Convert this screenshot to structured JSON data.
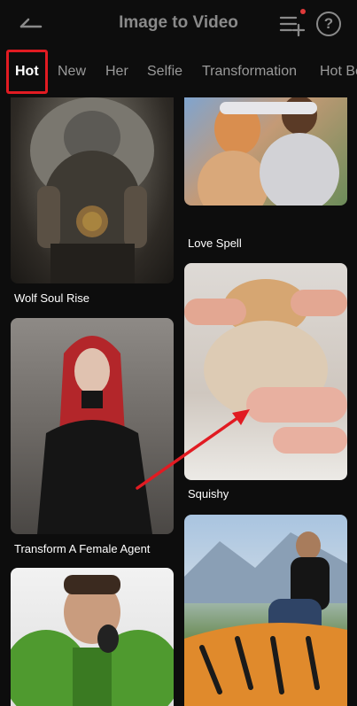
{
  "header": {
    "title": "Image to Video",
    "back_icon": "back-arrow-icon",
    "queue_icon": "task-list-icon",
    "help_icon": "help-circle-icon",
    "help_glyph": "?"
  },
  "tabs": [
    {
      "label": "Hot",
      "active": true
    },
    {
      "label": "New",
      "active": false
    },
    {
      "label": "Her",
      "active": false
    },
    {
      "label": "Selfie",
      "active": false
    },
    {
      "label": "Transformation",
      "active": false
    },
    {
      "label": "Hot Be",
      "active": false
    }
  ],
  "cards": {
    "wolf": {
      "caption": "Wolf Soul Rise"
    },
    "love": {
      "caption": "Love Spell"
    },
    "agent": {
      "caption": "Transform A Female Agent"
    },
    "squishy": {
      "caption": "Squishy"
    },
    "hulk": {
      "caption": ""
    },
    "tiger": {
      "caption": ""
    }
  },
  "colors": {
    "background": "#0d0d0d",
    "highlight_box": "#e11b22",
    "annotation_arrow": "#e11b22"
  }
}
